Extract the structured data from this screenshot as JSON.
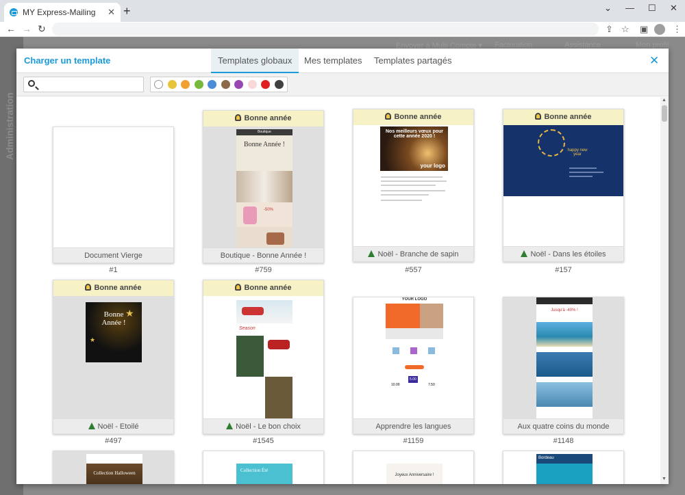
{
  "browser": {
    "tab_title": "MY Express-Mailing",
    "tab_close": "✕",
    "new_tab": "+",
    "back": "←",
    "forward": "→",
    "reload": "↻",
    "minimize": "—",
    "maximize": "☐",
    "close": "✕",
    "share": "⇪",
    "star": "☆",
    "sidepanel": "▣",
    "menu": "⋮"
  },
  "background": {
    "side_label": "Administration",
    "menu": [
      "Envoyer à Multi Compte ▾",
      "Facturation",
      "Assistance",
      "Mon profil"
    ]
  },
  "modal": {
    "title": "Charger un template",
    "tabs": [
      "Templates globaux",
      "Mes templates",
      "Templates partagés"
    ],
    "close": "✕",
    "search": {
      "placeholder": "",
      "value": ""
    },
    "colors": [
      "#ffffff",
      "#e8c43a",
      "#f0a030",
      "#78b83c",
      "#4a8cd8",
      "#8b6a48",
      "#9848b0",
      "#f8d8d8",
      "#e02020",
      "#404040"
    ]
  },
  "templates": [
    {
      "name": "Document Vierge",
      "id": "#1",
      "tag": "",
      "icon": ""
    },
    {
      "name": "Boutique - Bonne Année !",
      "id": "#759",
      "tag": "Bonne année",
      "icon": ""
    },
    {
      "name": "Noël - Branche de sapin",
      "id": "#557",
      "tag": "Bonne année",
      "icon": "tree"
    },
    {
      "name": "Noël - Dans les étoiles",
      "id": "#157",
      "tag": "Bonne année",
      "icon": "tree"
    },
    {
      "name": "Noël - Etoilé",
      "id": "#497",
      "tag": "Bonne année",
      "icon": "tree"
    },
    {
      "name": "Noël - Le bon choix",
      "id": "#1545",
      "tag": "Bonne année",
      "icon": "tree"
    },
    {
      "name": "Apprendre les langues",
      "id": "#1159",
      "tag": "",
      "icon": ""
    },
    {
      "name": "Aux quatre coins du monde",
      "id": "#1148",
      "tag": "",
      "icon": ""
    }
  ],
  "previews": {
    "boutique": {
      "logo": "Boutique",
      "headline": "Bonne Année !",
      "promo": "-50%"
    },
    "sapin": {
      "text": "Nos meilleurs vœux pour cette année 2020 !",
      "logo": "your logo"
    },
    "etoiles": {
      "text": "happy new year"
    },
    "etoile": {
      "line1": "Bonne",
      "line2": "Année !"
    },
    "choix": {
      "brand": "Season"
    },
    "langues": {
      "logo": "YOUR LOGO",
      "prices": [
        "10.00",
        "5.00",
        "7.50"
      ]
    },
    "monde": {
      "text": "Jusqu'à -40% !"
    },
    "bottom": [
      "Collection Halloween",
      "Collection Été",
      "Joyeux Anniversaire !",
      "Bordeau"
    ]
  }
}
